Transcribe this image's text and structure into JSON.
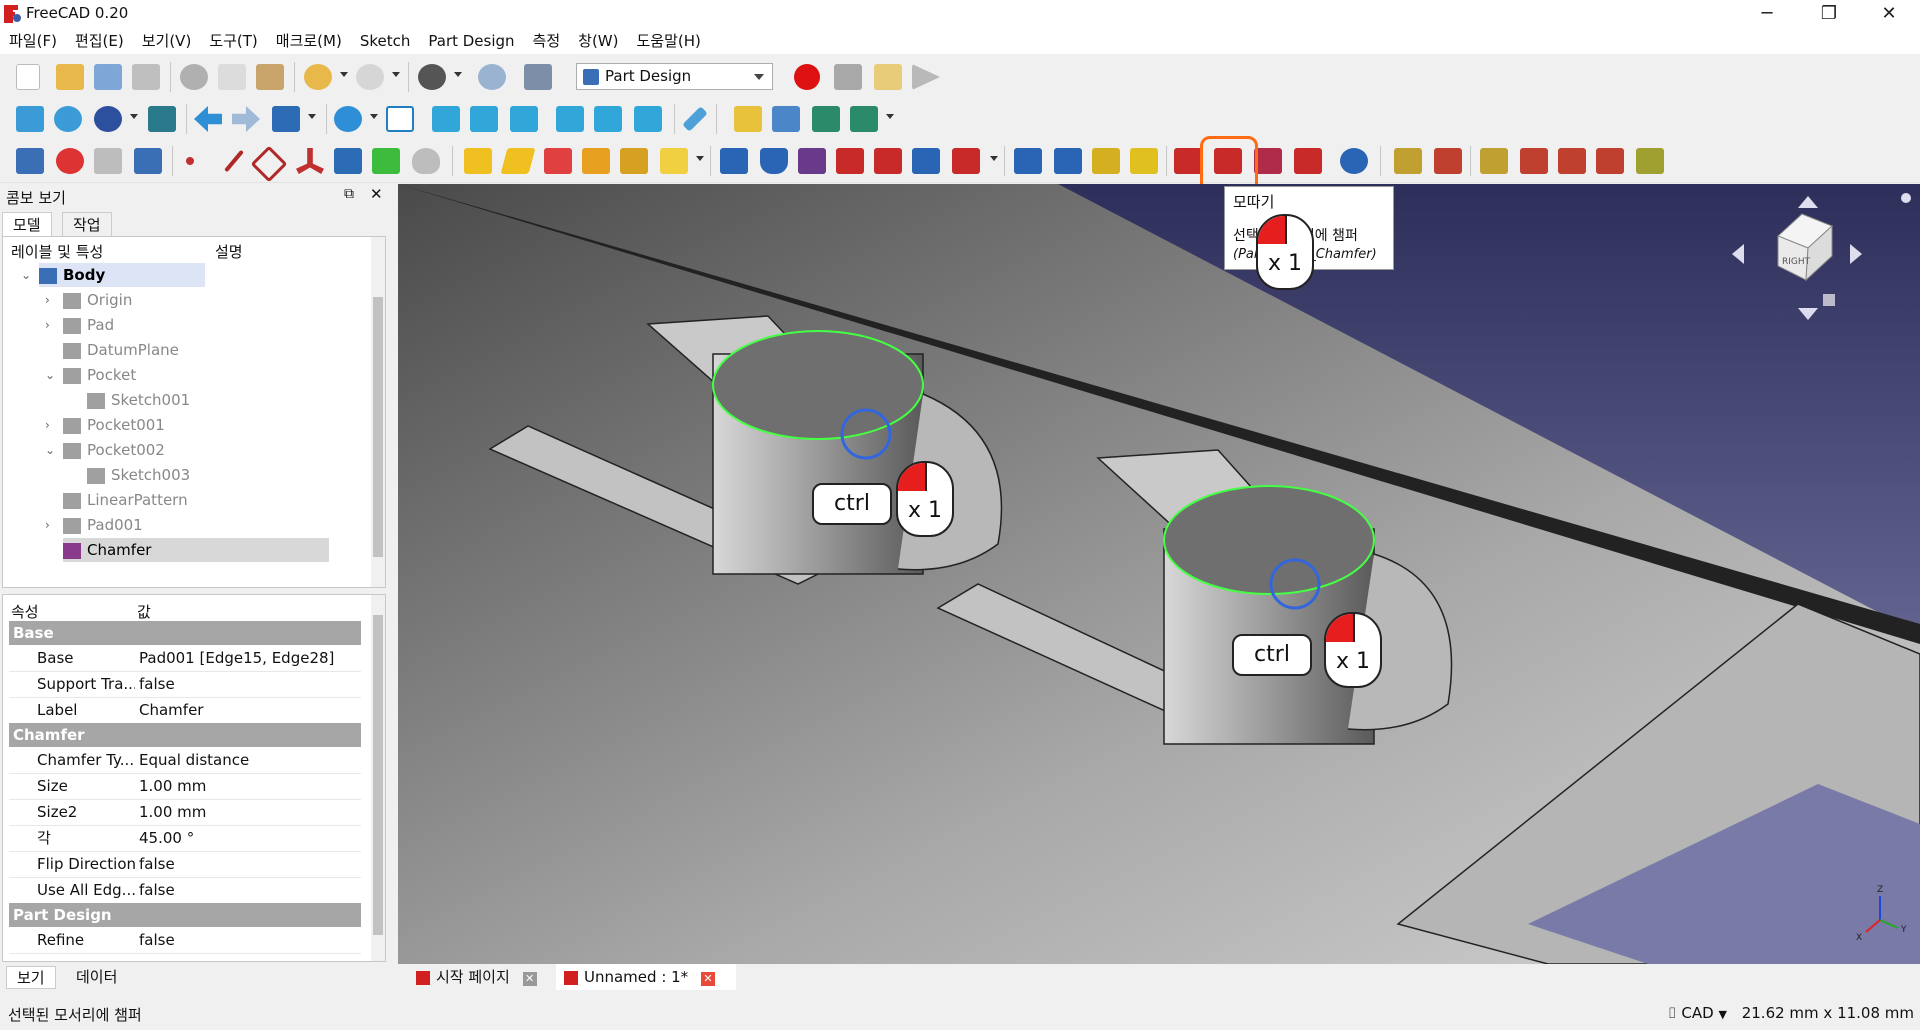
{
  "window": {
    "title": "FreeCAD 0.20",
    "minimize": "─",
    "maximize": "❐",
    "close": "✕"
  },
  "menu": [
    "파일(F)",
    "편집(E)",
    "보기(V)",
    "도구(T)",
    "매크로(M)",
    "Sketch",
    "Part Design",
    "측정",
    "창(W)",
    "도움말(H)"
  ],
  "workbench": {
    "selected": "Part Design"
  },
  "combo": {
    "title": "콤보 보기",
    "tabs": [
      "모델",
      "작업"
    ],
    "tree_headers": [
      "레이블 및 특성",
      "설명"
    ],
    "tree": [
      {
        "label": "Body",
        "level": 0,
        "expand": "v",
        "bold": true
      },
      {
        "label": "Origin",
        "level": 1,
        "expand": ">"
      },
      {
        "label": "Pad",
        "level": 1,
        "expand": ">"
      },
      {
        "label": "DatumPlane",
        "level": 1,
        "expand": ""
      },
      {
        "label": "Pocket",
        "level": 1,
        "expand": "v"
      },
      {
        "label": "Sketch001",
        "level": 2,
        "expand": ""
      },
      {
        "label": "Pocket001",
        "level": 1,
        "expand": ">"
      },
      {
        "label": "Pocket002",
        "level": 1,
        "expand": "v"
      },
      {
        "label": "Sketch003",
        "level": 2,
        "expand": ""
      },
      {
        "label": "LinearPattern",
        "level": 1,
        "expand": ""
      },
      {
        "label": "Pad001",
        "level": 1,
        "expand": ">"
      },
      {
        "label": "Chamfer",
        "level": 1,
        "expand": "",
        "selected": true
      }
    ],
    "props_headers": [
      "속성",
      "값"
    ],
    "props": [
      {
        "group": "Base"
      },
      {
        "k": "Base",
        "v": "Pad001 [Edge15, Edge28]"
      },
      {
        "k": "Support Tra...",
        "v": "false"
      },
      {
        "k": "Label",
        "v": "Chamfer"
      },
      {
        "group": "Chamfer"
      },
      {
        "k": "Chamfer Ty...",
        "v": "Equal distance"
      },
      {
        "k": "Size",
        "v": "1.00 mm"
      },
      {
        "k": "Size2",
        "v": "1.00 mm"
      },
      {
        "k": "각",
        "v": "45.00 °"
      },
      {
        "k": "Flip Direction",
        "v": "false"
      },
      {
        "k": "Use All Edg...",
        "v": "false"
      },
      {
        "group": "Part Design"
      },
      {
        "k": "Refine",
        "v": "false"
      }
    ],
    "bottom_tabs": [
      "보기",
      "데이터"
    ]
  },
  "doc_tabs": [
    {
      "label": "시작 페이지"
    },
    {
      "label": "Unnamed : 1*"
    }
  ],
  "tooltip": {
    "title": "모따기",
    "line1": "선택된 모서리에 챔퍼",
    "line2": "(PartDesign_Chamfer)"
  },
  "callouts": {
    "ctrl": "ctrl",
    "x1": "x 1"
  },
  "status": {
    "text": "선택된 모서리에 챔퍼",
    "nav": "CAD",
    "dims": "21.62 mm x 11.08 mm"
  },
  "nav_cube": {
    "face": "RIGHT"
  },
  "axes": {
    "x": "X",
    "y": "Y",
    "z": "Z"
  },
  "colors": {
    "accent_orange": "#ff6a13",
    "selection_green": "#44ff44",
    "pick_blue": "#3366dd",
    "mouse_red": "#e61e1e"
  }
}
